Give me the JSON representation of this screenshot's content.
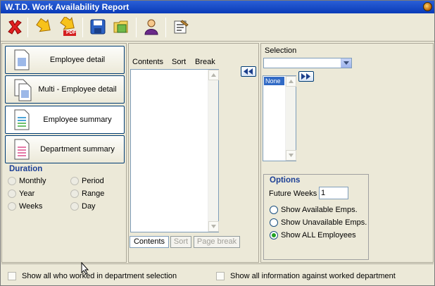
{
  "window": {
    "title": "W.T.D. Work Availability Report"
  },
  "toolbar": {
    "buttons": [
      {
        "name": "close-report-button",
        "icon": "red-x-icon"
      },
      {
        "name": "run-report-button",
        "icon": "arrow-right-icon"
      },
      {
        "name": "export-pdf-button",
        "icon": "pdf-arrow-icon",
        "badge": "PDF"
      },
      {
        "name": "save-button",
        "icon": "floppy-disk-icon"
      },
      {
        "name": "open-folder-button",
        "icon": "folder-icon"
      },
      {
        "name": "user-button",
        "icon": "user-icon"
      },
      {
        "name": "properties-button",
        "icon": "clipboard-icon"
      }
    ]
  },
  "report_types": [
    {
      "label": "Employee detail",
      "selected": false
    },
    {
      "label": "Multi - Employee detail",
      "selected": false
    },
    {
      "label": "Employee summary",
      "selected": true
    },
    {
      "label": "Department summary",
      "selected": false
    }
  ],
  "duration": {
    "title": "Duration",
    "options": [
      "Monthly",
      "Period",
      "Year",
      "Range",
      "Weeks",
      "Day"
    ]
  },
  "columns": {
    "contents_header": "Contents",
    "sort_header": "Sort",
    "break_header": "Break"
  },
  "bottom_tabs": {
    "contents": "Contents",
    "sort": "Sort",
    "page_break": "Page break"
  },
  "selection": {
    "label": "Selection",
    "dropdown_value": "",
    "list_items": [
      "None"
    ]
  },
  "options": {
    "title": "Options",
    "future_weeks_label": "Future Weeks",
    "future_weeks_value": "1",
    "radios": [
      {
        "label": "Show Available Emps.",
        "checked": false
      },
      {
        "label": "Show Unavailable Emps.",
        "checked": false
      },
      {
        "label": "Show ALL Employees",
        "checked": true
      }
    ]
  },
  "footer": {
    "checkbox_left": "Show all who worked in department selection",
    "checkbox_right": "Show all information against worked department"
  },
  "colors": {
    "title_bar": "#0a3bb8",
    "section_title": "#1c3f95",
    "selected_list": "#316ac5",
    "radio_checked": "#21a121"
  }
}
